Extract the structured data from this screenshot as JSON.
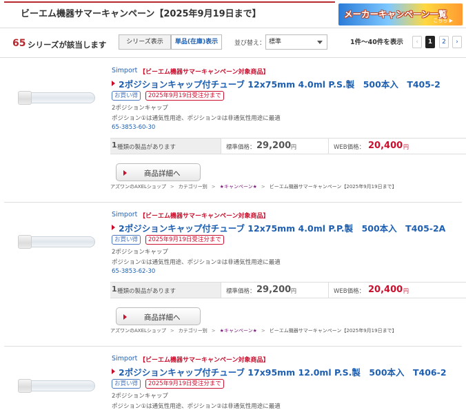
{
  "header": {
    "title": "ビーエム機器サマーキャンペーン【2025年9月19日まで】",
    "banner_text": "メーカーキャンペーン一覧",
    "banner_sub": "こちら ▶"
  },
  "results": {
    "count": "65",
    "count_suffix": "シリーズが該当します",
    "view_series": "シリーズ表示",
    "view_single": "単品(在庫)表示",
    "sort_label": "並び替え：",
    "sort_value": "標準",
    "range": "1件～40件を表示",
    "pages": [
      "‹",
      "1",
      "2",
      "›"
    ]
  },
  "products": [
    {
      "brand": "Simport",
      "campaign": "【ビーエム機器サマーキャンペーン対象商品】",
      "name": "2ポジションキャップ付チューブ 12x75mm 4.0ml P.S.製　500本入　T405-2",
      "badge_blue": "お買い得",
      "badge_red": "2025年9月19日受注分まで",
      "type": "2ポジションキャップ",
      "desc": "ポジション①は通気性用途、ポジション②は非通気性用途に最適",
      "catno": "65-3853-60-30",
      "kinds_num": "1",
      "kinds_text": "種類の製品があります",
      "std_label": "標準価格：",
      "std_price": "29,200",
      "std_unit": "円",
      "web_label": "WEB価格：",
      "web_price": "20,400",
      "web_unit": "円",
      "detail": "商品詳細へ",
      "crumbs": [
        "アズワンのAXELショップ",
        "カテゴリー别",
        "★キャンペーン★",
        "ビーエム機器サマーキャンペーン【2025年9月19日まで】"
      ]
    },
    {
      "brand": "Simport",
      "campaign": "【ビーエム機器サマーキャンペーン対象商品】",
      "name": "2ポジションキャップ付チューブ 12x75mm 4.0ml P.P.製　500本入　T405-2A",
      "badge_blue": "お買い得",
      "badge_red": "2025年9月19日受注分まで",
      "type": "2ポジションキャップ",
      "desc": "ポジション①は通気性用途、ポジション②は非通気性用途に最適",
      "catno": "65-3853-62-30",
      "kinds_num": "1",
      "kinds_text": "種類の製品があります",
      "std_label": "標準価格：",
      "std_price": "29,200",
      "std_unit": "円",
      "web_label": "WEB価格：",
      "web_price": "20,400",
      "web_unit": "円",
      "detail": "商品詳細へ",
      "crumbs": [
        "アズワンのAXELショップ",
        "カテゴリー别",
        "★キャンペーン★",
        "ビーエム機器サマーキャンペーン【2025年9月19日まで】"
      ]
    },
    {
      "brand": "Simport",
      "campaign": "【ビーエム機器サマーキャンペーン対象商品】",
      "name": "2ポジションキャップ付チューブ 17x95mm 12.0ml P.S.製　500本入　T406-2",
      "badge_blue": "お買い得",
      "badge_red": "2025年9月19日受注分まで",
      "type": "2ポジションキャップ",
      "desc": "ポジション①は通気性用途、ポジション②は非通気性用途に最適"
    }
  ]
}
